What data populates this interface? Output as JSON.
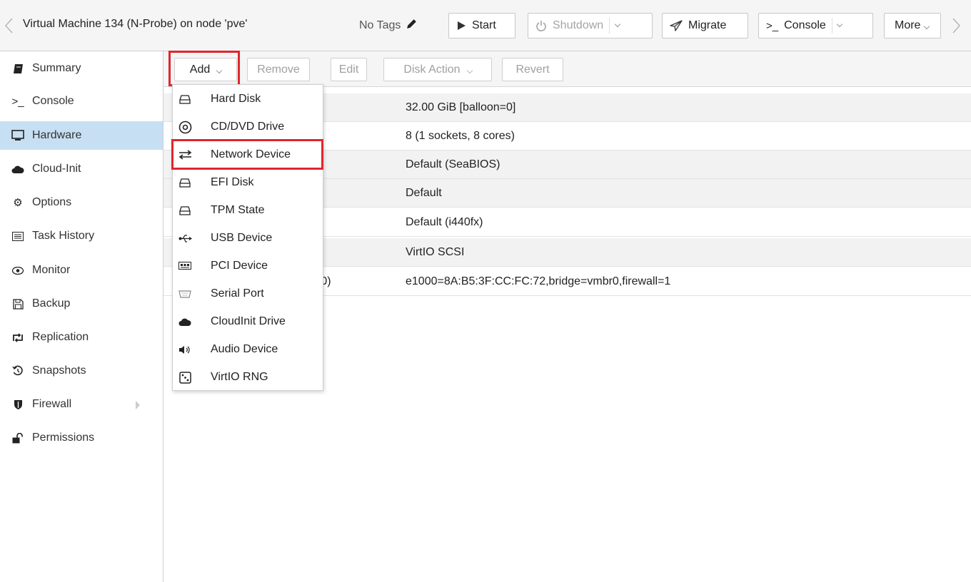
{
  "header": {
    "title": "Virtual Machine 134 (N-Probe) on node 'pve'",
    "tags_label": "No Tags",
    "buttons": {
      "start": "Start",
      "shutdown": "Shutdown",
      "migrate": "Migrate",
      "console": "Console",
      "more": "More"
    }
  },
  "sidebar": {
    "items": [
      {
        "label": "Summary",
        "icon": "book-icon"
      },
      {
        "label": "Console",
        "icon": "terminal-icon"
      },
      {
        "label": "Hardware",
        "icon": "desktop-icon",
        "active": true
      },
      {
        "label": "Cloud-Init",
        "icon": "cloud-icon"
      },
      {
        "label": "Options",
        "icon": "gear-icon"
      },
      {
        "label": "Task History",
        "icon": "list-icon"
      },
      {
        "label": "Monitor",
        "icon": "eye-icon"
      },
      {
        "label": "Backup",
        "icon": "floppy-icon"
      },
      {
        "label": "Replication",
        "icon": "retweet-icon"
      },
      {
        "label": "Snapshots",
        "icon": "history-icon"
      },
      {
        "label": "Firewall",
        "icon": "shield-icon"
      },
      {
        "label": "Permissions",
        "icon": "unlock-icon"
      }
    ]
  },
  "toolbar": {
    "add": "Add",
    "remove": "Remove",
    "edit": "Edit",
    "disk_action": "Disk Action",
    "revert": "Revert"
  },
  "hardware_rows": [
    {
      "key": "",
      "value": "32.00 GiB [balloon=0]"
    },
    {
      "key": "",
      "value": "8 (1 sockets, 8 cores)"
    },
    {
      "key": "",
      "value": "Default (SeaBIOS)"
    },
    {
      "key": "",
      "value": "Default"
    },
    {
      "key": "",
      "value": "Default (i440fx)"
    },
    {
      "key": "",
      "value": "VirtIO SCSI"
    },
    {
      "key": "et0)",
      "value": "e1000=8A:B5:3F:CC:FC:72,bridge=vmbr0,firewall=1"
    }
  ],
  "add_menu": {
    "items": [
      {
        "label": "Hard Disk",
        "icon": "hdd-icon"
      },
      {
        "label": "CD/DVD Drive",
        "icon": "cdrom-icon"
      },
      {
        "label": "Network Device",
        "icon": "exchange-icon",
        "highlighted": true
      },
      {
        "label": "EFI Disk",
        "icon": "hdd-icon"
      },
      {
        "label": "TPM State",
        "icon": "hdd-icon"
      },
      {
        "label": "USB Device",
        "icon": "usb-icon"
      },
      {
        "label": "PCI Device",
        "icon": "pci-card-icon"
      },
      {
        "label": "Serial Port",
        "icon": "serial-port-icon"
      },
      {
        "label": "CloudInit Drive",
        "icon": "cloud-icon"
      },
      {
        "label": "Audio Device",
        "icon": "volume-icon"
      },
      {
        "label": "VirtIO RNG",
        "icon": "dice-icon"
      }
    ]
  },
  "colors": {
    "highlight": "#e0262e",
    "active_sidebar": "#c7dff2"
  }
}
